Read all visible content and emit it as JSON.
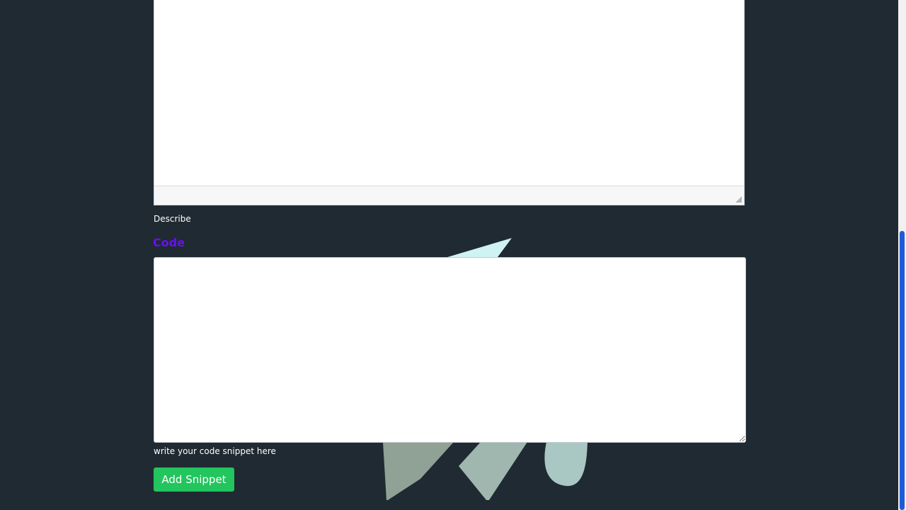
{
  "description_editor": {
    "content": ""
  },
  "describe_help": "Describe",
  "code_section": {
    "label": "Code",
    "value": "",
    "placeholder": "",
    "help": "write your code snippet here"
  },
  "submit": {
    "label": "Add Snippet"
  },
  "colors": {
    "page_background": "#202a32",
    "code_label": "#6610f2",
    "submit_button": "#22c55e",
    "scrollbar_thumb": "#1e5bd7"
  }
}
